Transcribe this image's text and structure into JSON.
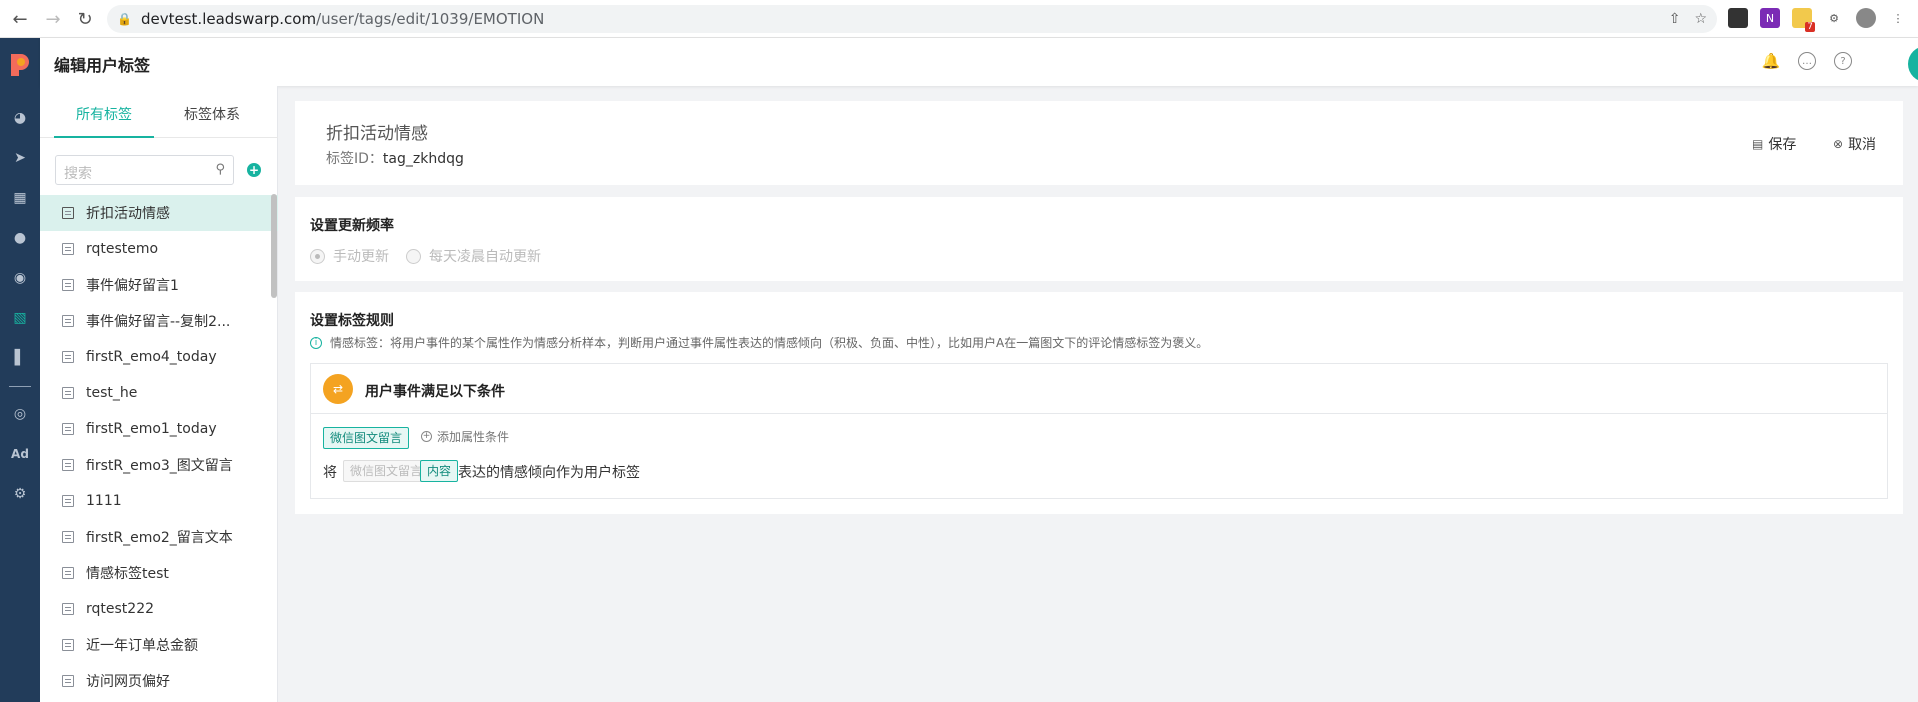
{
  "browser": {
    "url_host": "devtest.leadswarp.com",
    "url_path": "/user/tags/edit/1039/EMOTION",
    "ext_badge": "7"
  },
  "header": {
    "title": "编辑用户标签"
  },
  "sidebar": {
    "tabs": [
      "所有标签",
      "标签体系"
    ],
    "search_placeholder": "搜索",
    "add_symbol": "+",
    "items": [
      "折扣活动情感",
      "rqtestemo",
      "事件偏好留言1",
      "事件偏好留言--复制2...",
      "firstR_emo4_today",
      "test_he",
      "firstR_emo1_today",
      "firstR_emo3_图文留言",
      "1111",
      "firstR_emo2_留言文本",
      "情感标签test",
      "rqtest222",
      "近一年订单总金额",
      "访问网页偏好"
    ]
  },
  "tag": {
    "name": "折扣活动情感",
    "id_label": "标签ID：",
    "id_value": "tag_zkhdqg",
    "save_label": "保存",
    "cancel_label": "取消"
  },
  "frequency": {
    "title": "设置更新频率",
    "options": [
      "手动更新",
      "每天凌晨自动更新"
    ],
    "selected": "手动更新"
  },
  "rules": {
    "title": "设置标签规则",
    "info": "情感标签：将用户事件的某个属性作为情感分析样本，判断用户通过事件属性表达的情感倾向（积极、负面、中性），比如用户A在一篇图文下的评论情感标签为褒义。",
    "condition_title": "用户事件满足以下条件",
    "event_chip": "微信图文留言",
    "add_condition": "添加属性条件",
    "sentence_prefix": "将",
    "sentence_event": "微信图文留言",
    "sentence_attr": "内容",
    "sentence_suffix": "表达的情感倾向作为用户标签"
  },
  "colors": {
    "accent": "#17b3a0",
    "rail": "#223c5a",
    "badge": "#f4a321"
  }
}
